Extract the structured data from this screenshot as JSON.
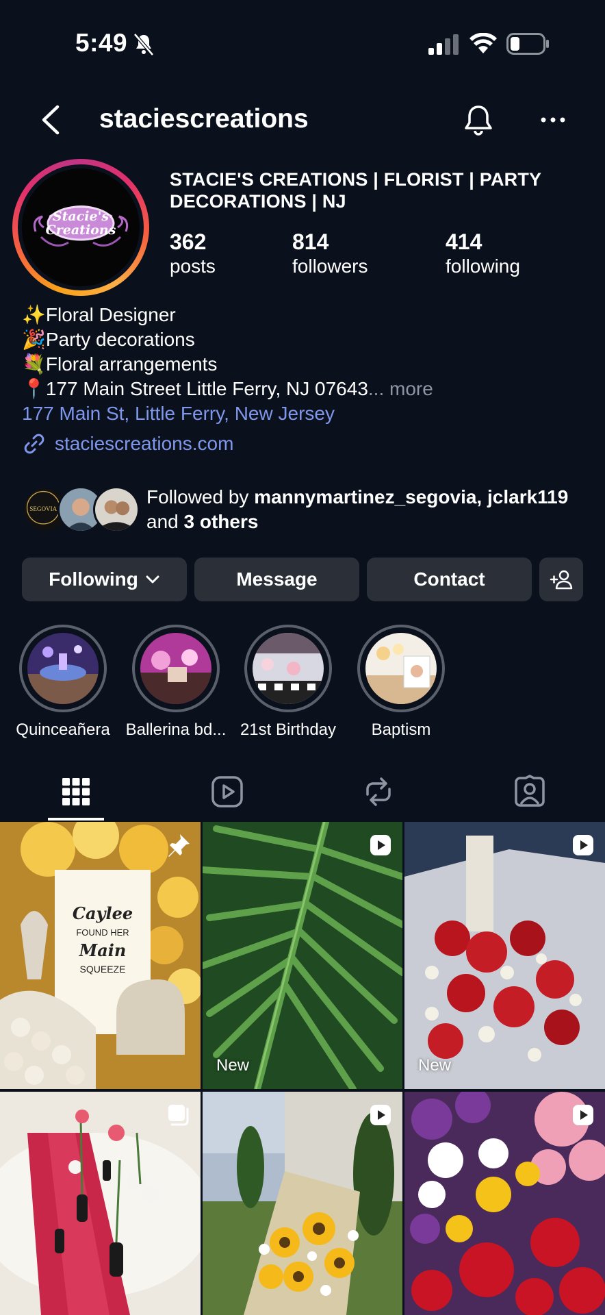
{
  "status_bar": {
    "time": "5:49"
  },
  "nav": {
    "username": "staciescreations"
  },
  "profile": {
    "avatar_text_line1": "Stacie's",
    "avatar_text_line2": "Creations",
    "display_name": "STACIE'S CREATIONS | FLORIST | PARTY DECORATIONS | NJ",
    "stats": [
      {
        "value": "362",
        "label": "posts"
      },
      {
        "value": "814",
        "label": "followers"
      },
      {
        "value": "414",
        "label": "following"
      }
    ],
    "bio_lines": [
      "✨Floral Designer",
      "🎉Party decorations",
      "💐Floral arrangements",
      "📍177 Main Street Little Ferry, NJ 07643"
    ],
    "bio_ellipsis": "...",
    "more_label": "more",
    "location_link": "177 Main St, Little Ferry, New Jersey",
    "website": "staciescreations.com"
  },
  "followed_by": {
    "prefix": "Followed by ",
    "names": "mannymartinez_segovia, jclark119",
    "and": " and ",
    "others": "3 others",
    "fav1_text": "SEGOVIA"
  },
  "actions": {
    "following": "Following",
    "message": "Message",
    "contact": "Contact"
  },
  "highlights": [
    {
      "label": "Quinceañera"
    },
    {
      "label": "Ballerina bd..."
    },
    {
      "label": "21st Birthday"
    },
    {
      "label": "Baptism"
    }
  ],
  "grid": {
    "new_label": "New",
    "image_texts": {
      "caylee": "Caylee",
      "found": "FOUND HER",
      "main": "Main",
      "squeeze": "SQUEEZE"
    }
  },
  "colors": {
    "background": "#0b111c",
    "button": "#2a2f38",
    "link": "#7f97ec",
    "muted": "#8e96a3"
  },
  "icons": [
    "bell-slash-icon",
    "signal-icon",
    "wifi-icon",
    "battery-icon",
    "back-arrow-icon",
    "notification-bell-icon",
    "more-options-icon",
    "link-icon",
    "chevron-down-icon",
    "add-person-icon",
    "grid-icon",
    "reels-icon",
    "reposts-icon",
    "tagged-icon",
    "pin-icon",
    "reel-icon",
    "carousel-icon"
  ]
}
